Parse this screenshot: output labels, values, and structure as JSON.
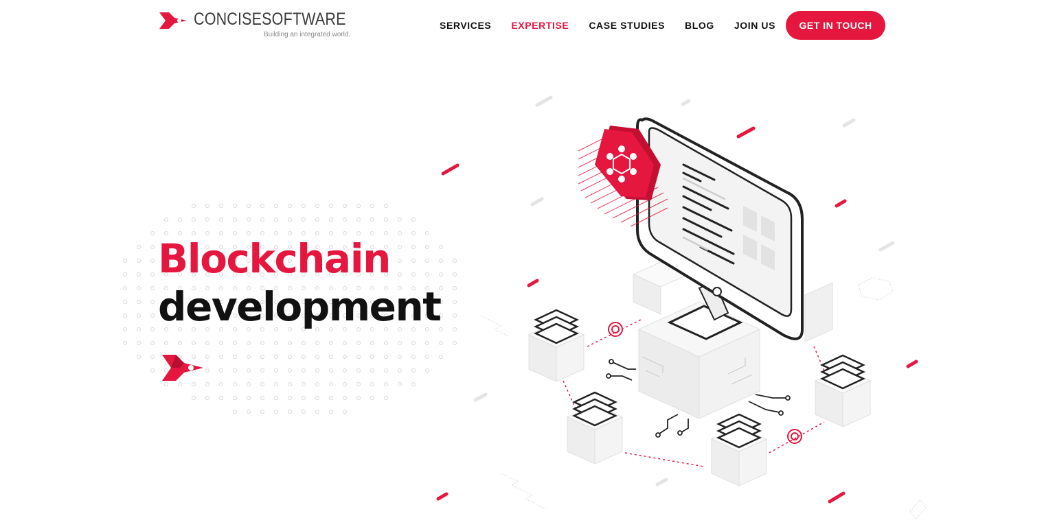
{
  "brand": {
    "name_bold": "CONCISE",
    "name_light": "SOFTWARE",
    "tagline": "Building an integrated world.",
    "accent_color": "#e5173f"
  },
  "nav": {
    "items": [
      {
        "label": "SERVICES",
        "active": false
      },
      {
        "label": "EXPERTISE",
        "active": true
      },
      {
        "label": "CASE STUDIES",
        "active": false
      },
      {
        "label": "BLOG",
        "active": false
      },
      {
        "label": "JOIN US",
        "active": false
      }
    ],
    "cta_label": "GET IN TOUCH"
  },
  "hero": {
    "title_line1": "Blockchain",
    "title_line2": "development",
    "icons": [
      "rocket-arrow-icon",
      "blockchain-illustration"
    ]
  }
}
